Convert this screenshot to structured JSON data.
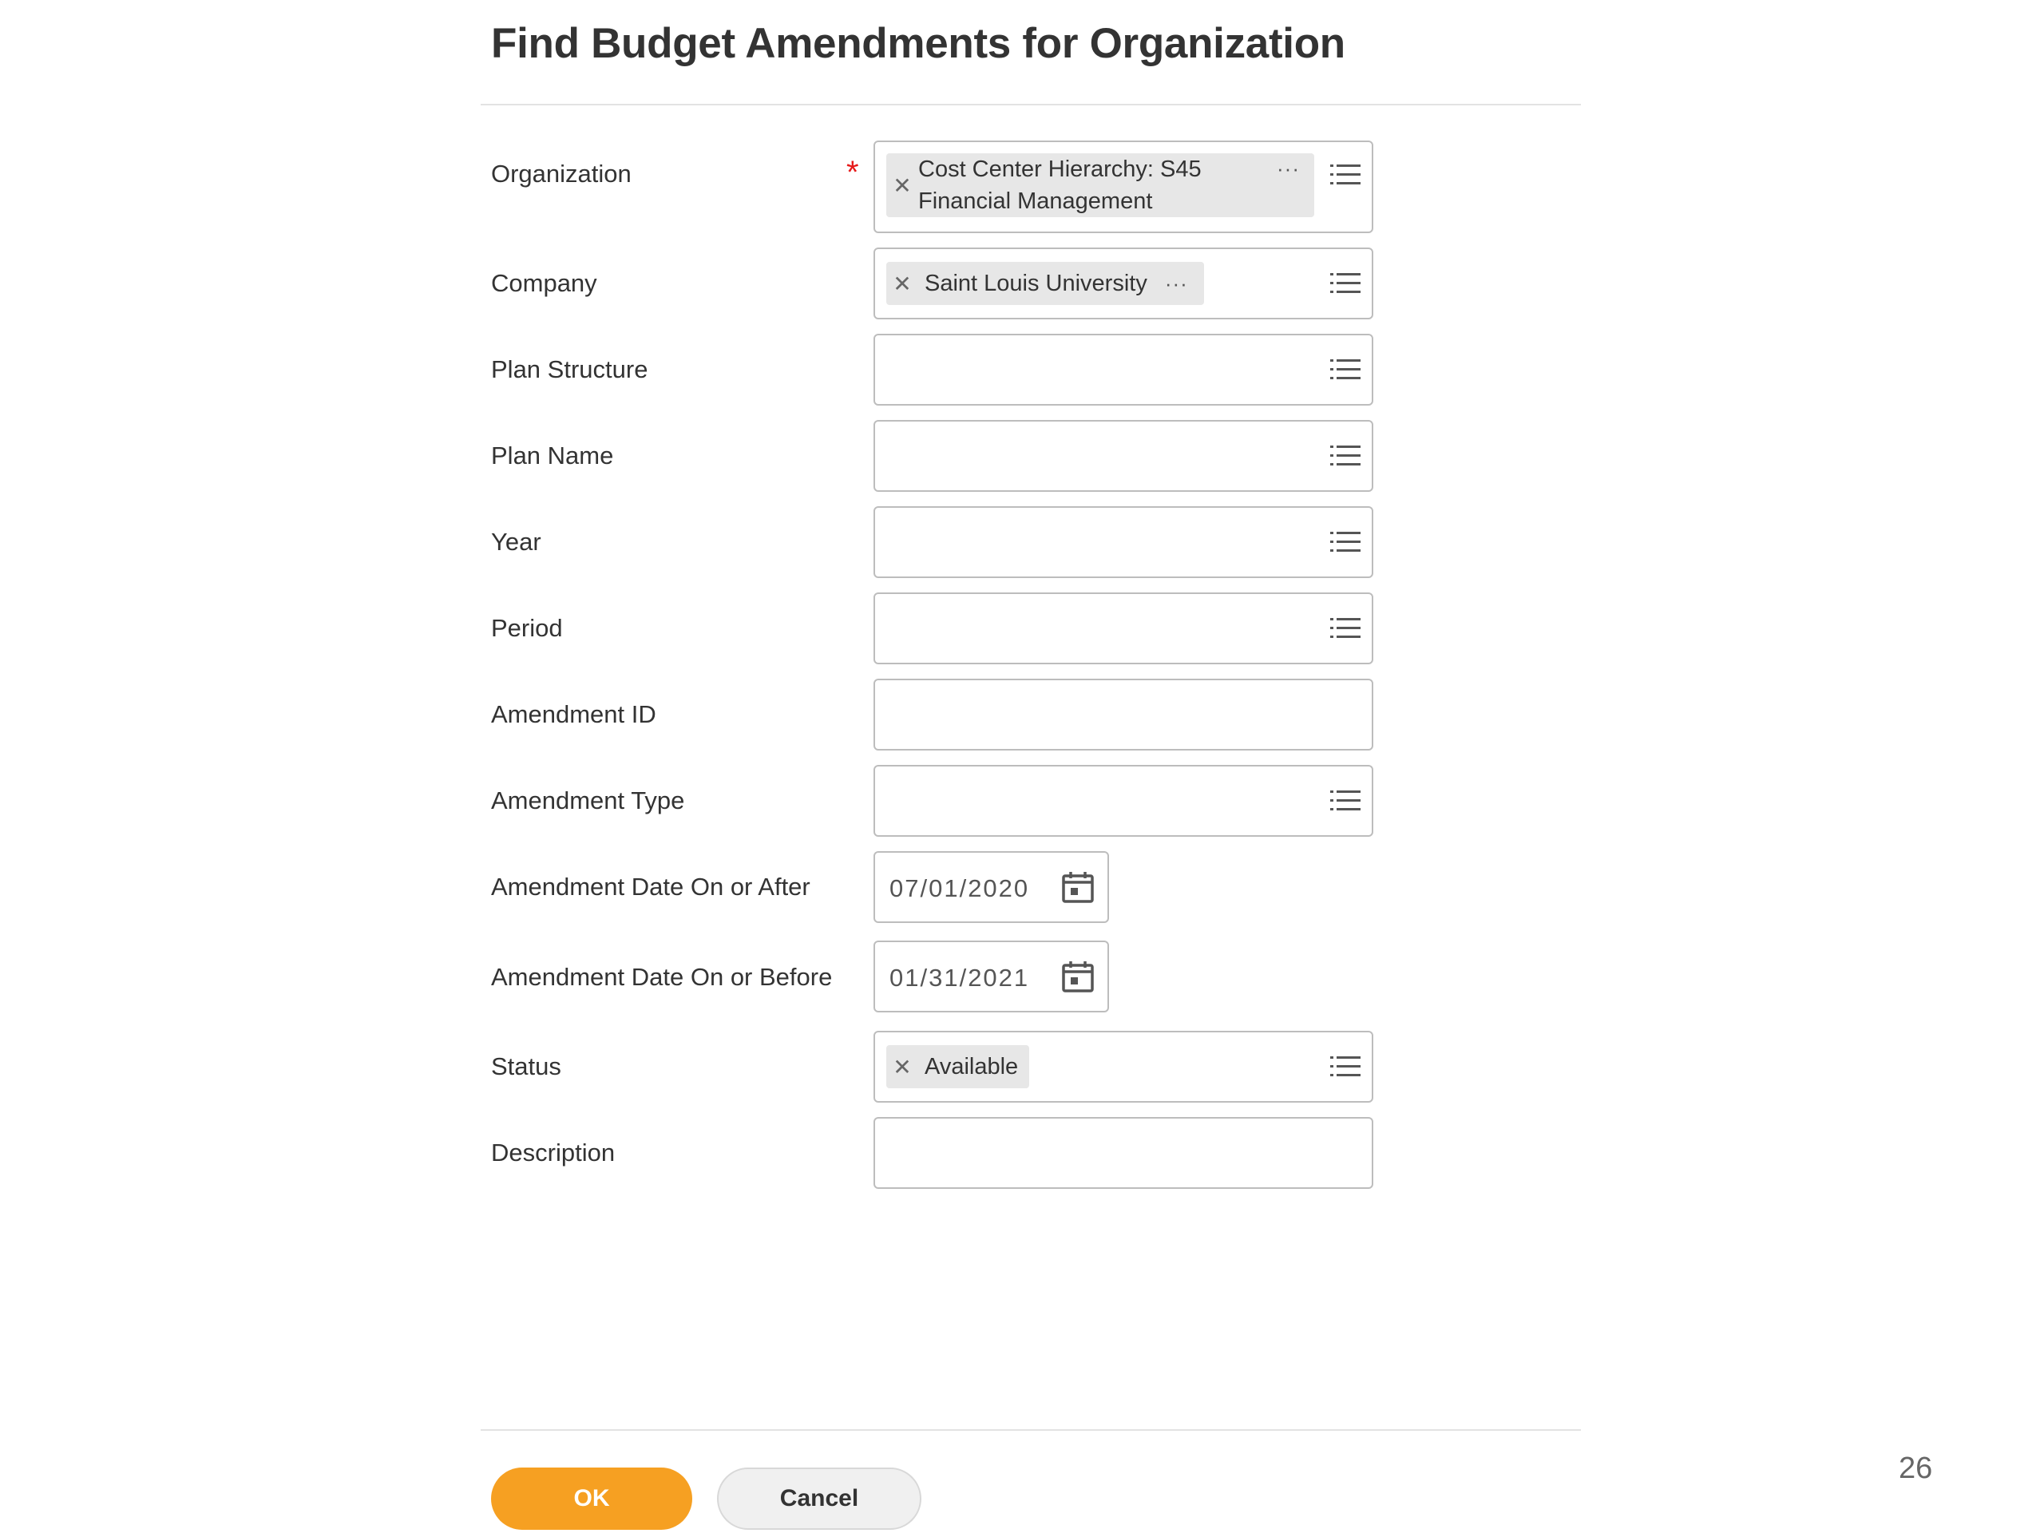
{
  "page": {
    "title": "Find Budget Amendments for Organization",
    "page_number": "26"
  },
  "form": {
    "organization": {
      "label": "Organization",
      "required_marker": "*",
      "selected_line1": "Cost Center Hierarchy: S45",
      "selected_line2": "Financial Management",
      "more": "···"
    },
    "company": {
      "label": "Company",
      "selected": "Saint Louis University",
      "more": "···"
    },
    "plan_structure": {
      "label": "Plan Structure",
      "value": ""
    },
    "plan_name": {
      "label": "Plan Name",
      "value": ""
    },
    "year": {
      "label": "Year",
      "value": ""
    },
    "period": {
      "label": "Period",
      "value": ""
    },
    "amendment_id": {
      "label": "Amendment ID",
      "value": ""
    },
    "amendment_type": {
      "label": "Amendment Type",
      "value": ""
    },
    "date_after": {
      "label": "Amendment Date On or After",
      "value": "07/01/2020"
    },
    "date_before": {
      "label": "Amendment Date On or Before",
      "value": "01/31/2021"
    },
    "status": {
      "label": "Status",
      "selected": "Available"
    },
    "description": {
      "label": "Description",
      "value": ""
    }
  },
  "buttons": {
    "ok": "OK",
    "cancel": "Cancel"
  },
  "icons": {
    "remove": "close-icon",
    "prompt": "list-icon",
    "calendar": "calendar-icon"
  },
  "colors": {
    "accent": "#f6a022",
    "required": "#e61919"
  }
}
